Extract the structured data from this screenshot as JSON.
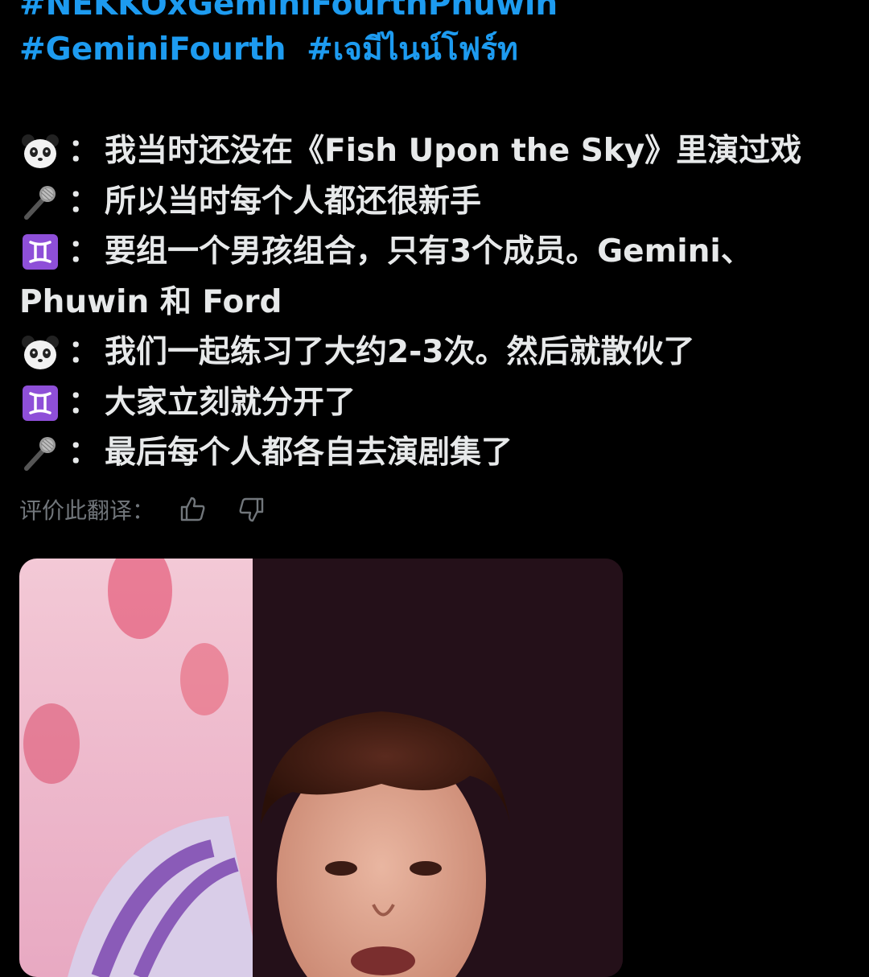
{
  "hashtags": {
    "line1": "#NEKKOxGeminiFourthPhuwin",
    "line2": [
      "#GeminiFourth",
      "#เจมีไนน์โฟร์ท"
    ]
  },
  "dialogue": [
    {
      "icon": "panda-icon",
      "text": "我当时还没在《Fish Upon the Sky》里演过戏"
    },
    {
      "icon": "microphone-icon",
      "text": "所以当时每个人都还很新手"
    },
    {
      "icon": "gemini-icon",
      "text": "要组一个男孩组合，只有3个成员。Gemini、"
    },
    {
      "icon": "",
      "text": "Phuwin 和 Ford"
    },
    {
      "icon": "panda-icon",
      "text": "我们一起练习了大约2-3次。然后就散伙了"
    },
    {
      "icon": "gemini-icon",
      "text": "大家立刻就分开了"
    },
    {
      "icon": "microphone-icon",
      "text": "最后每个人都各自去演剧集了"
    }
  ],
  "separator": "：",
  "translation_rating": {
    "label": "评价此翻译：",
    "like_icon": "thumbs-up-icon",
    "dislike_icon": "thumbs-down-icon"
  },
  "colors": {
    "background": "#000000",
    "text": "#e7e9ea",
    "link": "#1d9bf0",
    "muted": "#71767b",
    "gemini_badge": "#8e4fd8"
  }
}
